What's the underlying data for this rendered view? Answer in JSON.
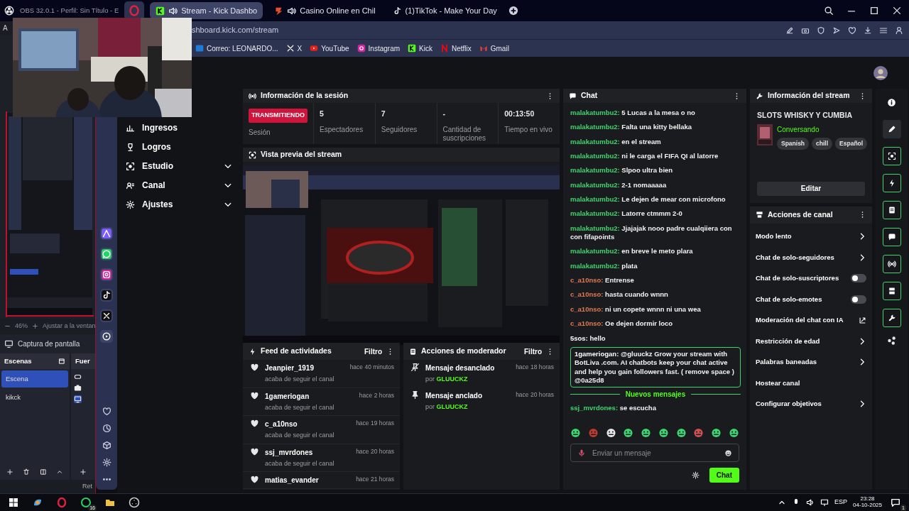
{
  "obs": {
    "title": "OBS 32.0.1 - Perfil: Sin Título - E",
    "menu": "A",
    "zoom": "46%",
    "fit": "Ajustar a la ventan",
    "source_label": "Captura de pantalla",
    "scenes_title": "Escenas",
    "scenes": [
      {
        "label": "Escena",
        "selected": true
      },
      {
        "label": "kikck",
        "selected": false
      }
    ],
    "sources_title": "Fuer",
    "bottom_label": "Ret"
  },
  "browser": {
    "tabs": [
      {
        "label": "Stream - Kick Dashbo",
        "selected": true,
        "audible": true
      },
      {
        "label": "Casino Online en Chil",
        "selected": false,
        "audible": true
      },
      {
        "label": "(1)TikTok - Make Your Day",
        "selected": false,
        "audible": false
      }
    ],
    "address": "shboard.kick.com/stream",
    "bookmarks": [
      "Correo: LEONARDO...",
      "X",
      "YouTube",
      "Instagram",
      "Kick",
      "Netflix",
      "Gmail"
    ]
  },
  "nav": [
    {
      "label": "Ingresos",
      "expandable": false
    },
    {
      "label": "Logros",
      "expandable": false
    },
    {
      "label": "Estudio",
      "expandable": true
    },
    {
      "label": "Canal",
      "expandable": true
    },
    {
      "label": "Ajustes",
      "expandable": true
    }
  ],
  "session": {
    "title": "Información de la sesión",
    "status": "TRANSMITIENDO",
    "status_label": "Sesión",
    "stats": [
      {
        "value": "5",
        "label": "Espectadores"
      },
      {
        "value": "7",
        "label": "Seguidores"
      },
      {
        "value": "-",
        "label": "Cantidad de suscripciones"
      },
      {
        "value": "00:13:50",
        "label": "Tiempo en vivo"
      }
    ]
  },
  "preview": {
    "title": "Vista previa del stream"
  },
  "feed": {
    "title": "Feed de actividades",
    "filter": "Filtro",
    "items": [
      {
        "user": "Jeanpier_1919",
        "action": "acaba de seguir el canal",
        "time": "hace 40 minutos"
      },
      {
        "user": "1gameriogan",
        "action": "acaba de seguir el canal",
        "time": "hace 2 horas"
      },
      {
        "user": "c_a10nso",
        "action": "acaba de seguir el canal",
        "time": "hace 19 horas"
      },
      {
        "user": "ssj_mvrdones",
        "action": "acaba de seguir el canal",
        "time": "hace 20 horas"
      },
      {
        "user": "matias_evander",
        "time": "hace 21 horas"
      }
    ]
  },
  "moderator": {
    "title": "Acciones de moderador",
    "filter": "Filtro",
    "items": [
      {
        "kind": "unpin",
        "action": "Mensaje desanclado",
        "by": "por",
        "moderator": "GLUUCKZ",
        "time": "hace 18 horas"
      },
      {
        "kind": "pin",
        "action": "Mensaje anclado",
        "by": "por",
        "moderator": "GLUUCKZ",
        "time": "hace 20 horas"
      }
    ]
  },
  "chat": {
    "title": "Chat",
    "messages": [
      {
        "kind": "message",
        "user": "malakatumbu2:",
        "color": "#3fd46e",
        "text": "5 Lucas a la mesa o no"
      },
      {
        "kind": "message",
        "user": "malakatumbu2:",
        "color": "#3fd46e",
        "text": "Falta una kitty bellaka"
      },
      {
        "kind": "message",
        "user": "malakatumbu2:",
        "color": "#3fd46e",
        "text": "en el stream"
      },
      {
        "kind": "message",
        "user": "malakatumbu2:",
        "color": "#3fd46e",
        "text": "ni le carga el FIFA QI al latorre"
      },
      {
        "kind": "message",
        "user": "malakatumbu2:",
        "color": "#3fd46e",
        "text": "Slpoo ultra bien"
      },
      {
        "kind": "message",
        "user": "malakatumbu2:",
        "color": "#3fd46e",
        "text": "2-1 nomaaaaa"
      },
      {
        "kind": "message",
        "user": "malakatumbu2:",
        "color": "#3fd46e",
        "text": "Le dejen de mear con microfono"
      },
      {
        "kind": "message",
        "user": "malakatumbu2:",
        "color": "#3fd46e",
        "text": "Latorre ctmmm 2-0"
      },
      {
        "kind": "message",
        "user": "malakatumbu2:",
        "color": "#3fd46e",
        "text": "Jjajajak nooo padre cualqiiera con con fifapoints"
      },
      {
        "kind": "message",
        "user": "malakatumbu2:",
        "color": "#3fd46e",
        "text": "en breve le meto plara"
      },
      {
        "kind": "message",
        "user": "malakatumbu2:",
        "color": "#3fd46e",
        "text": "plata"
      },
      {
        "kind": "message",
        "user": "c_a10nso:",
        "color": "#e07a52",
        "text": "Entrense"
      },
      {
        "kind": "message",
        "user": "c_a10nso:",
        "color": "#e07a52",
        "text": "hasta cuando wnnn"
      },
      {
        "kind": "message",
        "user": "c_a10nso:",
        "color": "#e07a52",
        "text": "ni un copete wnnn ni una wea"
      },
      {
        "kind": "message",
        "user": "c_a10nso:",
        "color": "#e07a52",
        "text": "Oe dejen dormir loco"
      },
      {
        "kind": "message",
        "user": "5sos:",
        "color": "#ffffff",
        "text": "hello"
      },
      {
        "kind": "highlight",
        "user": "1gameriogan:",
        "color": "#ffffff",
        "text": "@gluuckz Grow your stream with BotLiva .com. AI chatbots keep your chat active and help you gain followers fast. ( remove space ) @0a25d8"
      },
      {
        "kind": "divider",
        "text": "Nuevos mensajes"
      },
      {
        "kind": "message",
        "user": "ssj_mvrdones:",
        "color": "#3fd46e",
        "text": "se escucha"
      }
    ],
    "placeholder": "Enviar un mensaje",
    "send": "Chat"
  },
  "stream_info": {
    "title": "Información del stream",
    "stream_title": "SLOTS WHISKY Y CUMBIA",
    "category": "Conversando",
    "tags": [
      "Spanish",
      "chill",
      "Español"
    ],
    "edit": "Editar"
  },
  "channel_actions": {
    "title": "Acciones de canal",
    "items": [
      {
        "label": "Modo lento",
        "kind": "arrow"
      },
      {
        "label": "Chat de solo-seguidores",
        "kind": "arrow"
      },
      {
        "label": "Chat de solo-suscriptores",
        "kind": "toggle",
        "on": false
      },
      {
        "label": "Chat de solo-emotes",
        "kind": "toggle",
        "on": false
      },
      {
        "label": "Moderación del chat con IA",
        "kind": "external"
      },
      {
        "label": "Restricción de edad",
        "kind": "arrow"
      },
      {
        "label": "Palabras baneadas",
        "kind": "arrow"
      },
      {
        "label": "Hostear canal",
        "kind": "plain"
      },
      {
        "label": "Configurar objetivos",
        "kind": "arrow"
      }
    ]
  },
  "taskbar": {
    "whatsapp_badge": "16",
    "language": "ESP",
    "time": "23:28",
    "date": "04-10-2025",
    "notifications": "1"
  }
}
